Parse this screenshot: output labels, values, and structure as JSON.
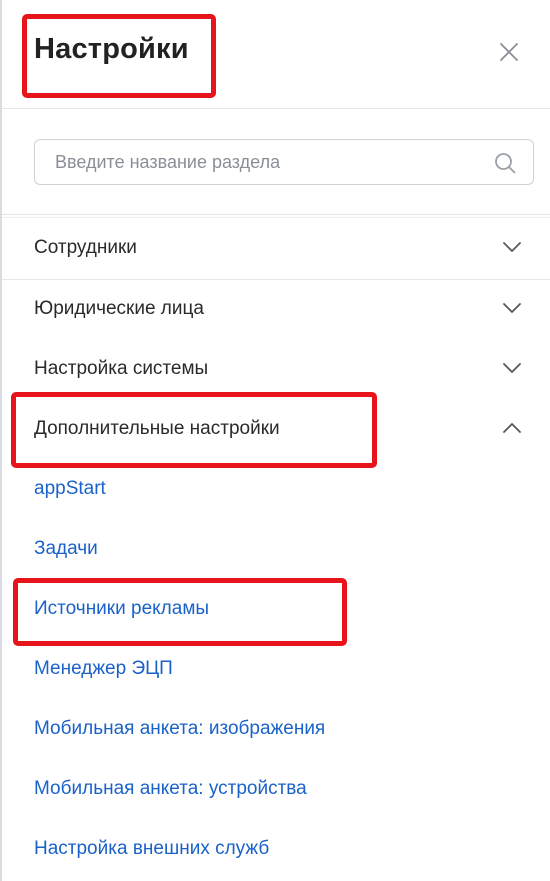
{
  "header": {
    "title": "Настройки",
    "close_icon": "close-icon"
  },
  "search": {
    "placeholder": "Введите название раздела",
    "value": "",
    "icon": "search-icon"
  },
  "sections": [
    {
      "label": "Сотрудники",
      "expanded": false,
      "icon": "chevron-down-icon"
    },
    {
      "label": "Юридические лица",
      "expanded": false,
      "icon": "chevron-down-icon"
    },
    {
      "label": "Настройка системы",
      "expanded": false,
      "icon": "chevron-down-icon"
    },
    {
      "label": "Дополнительные настройки",
      "expanded": true,
      "icon": "chevron-up-icon"
    }
  ],
  "subitems": [
    {
      "label": "appStart"
    },
    {
      "label": "Задачи"
    },
    {
      "label": "Источники рекламы"
    },
    {
      "label": "Менеджер ЭЦП"
    },
    {
      "label": "Мобильная анкета: изображения"
    },
    {
      "label": "Мобильная анкета: устройства"
    },
    {
      "label": "Настройка внешних служб"
    }
  ],
  "colors": {
    "link": "#1a62c9",
    "highlight": "#e8141b",
    "text": "#2a2a2a",
    "divider": "#e5e7eb"
  }
}
